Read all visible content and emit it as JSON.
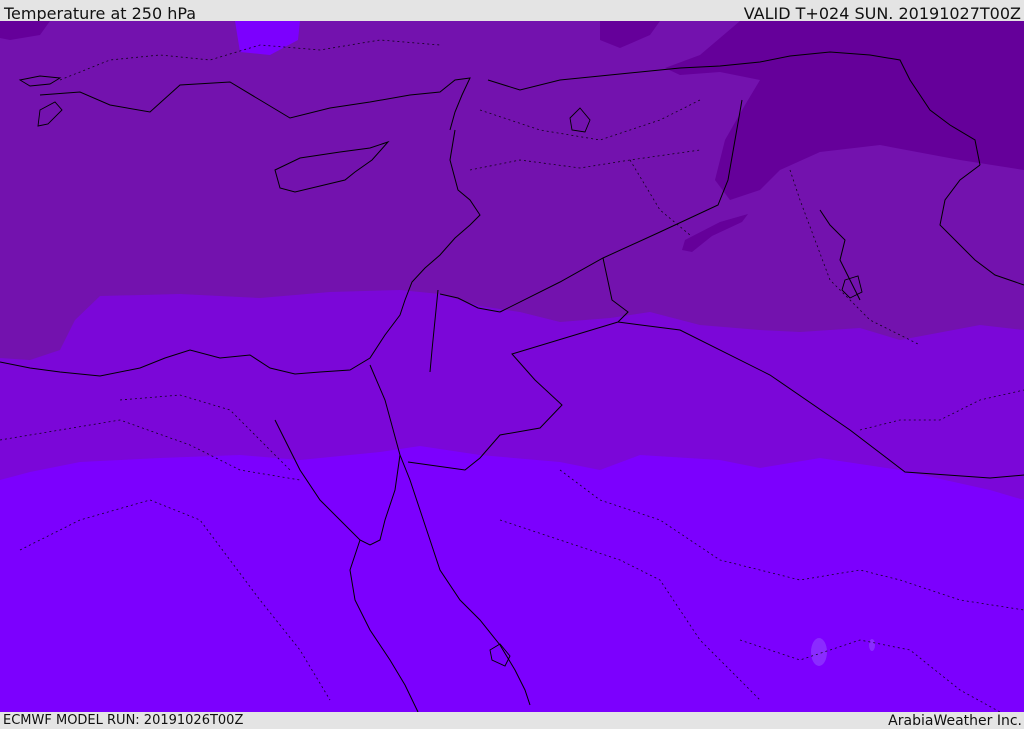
{
  "header": {
    "title": "Temperature at 250 hPa",
    "valid": "VALID T+024 SUN. 20191027T00Z"
  },
  "footer": {
    "model_run": "ECMWF MODEL RUN: 20191026T00Z",
    "credit": "ArabiaWeather Inc."
  },
  "map": {
    "colors": {
      "darkest": "#65009a",
      "dark": "#7312ae",
      "mid": "#7b07d8",
      "light": "#7c00fe",
      "lightest": "#8a2bff",
      "border": "#000000",
      "sea": "#7b07d8"
    }
  }
}
